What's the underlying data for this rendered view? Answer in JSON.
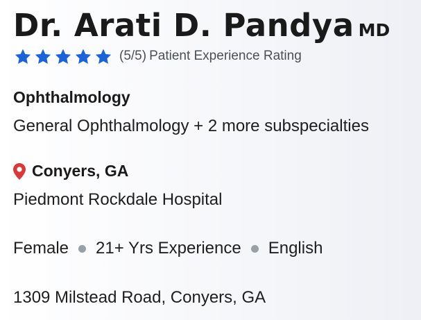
{
  "doctor": {
    "name": "Dr. Arati D. Pandya",
    "credential": "MD"
  },
  "rating": {
    "stars": 5,
    "max_stars": 5,
    "score_text": "(5/5)",
    "label": "Patient Experience Rating",
    "star_color": "#1e63d6"
  },
  "specialty": {
    "title": "Ophthalmology",
    "subspecialties": "General Ophthalmology + 2 more subspecialties"
  },
  "location": {
    "icon": "map-pin-icon",
    "pin_color": "#d63a3a",
    "city": "Conyers, GA",
    "hospital": "Piedmont Rockdale Hospital"
  },
  "attributes": {
    "gender": "Female",
    "experience": "21+ Yrs Experience",
    "language": "English"
  },
  "address": "1309 Milstead Road, Conyers, GA"
}
